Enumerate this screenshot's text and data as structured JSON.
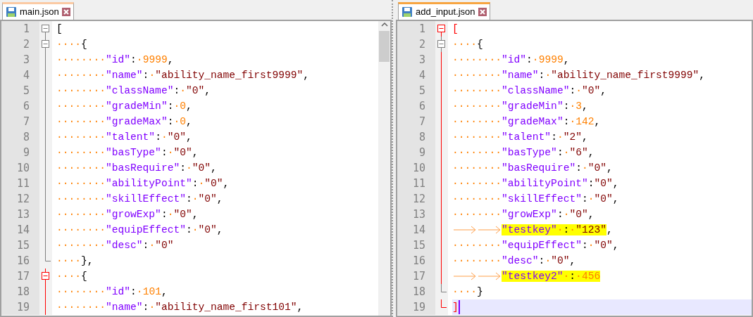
{
  "panes": [
    {
      "focused": false,
      "tab": {
        "label": "main.json",
        "selected": true
      },
      "scrollbar": true,
      "lines": [
        {
          "number": "1",
          "fold_marker": {
            "kind": "box",
            "active": false
          },
          "highlighted": false,
          "current": false,
          "tokens": [
            {
              "kind": "op",
              "text": "["
            }
          ]
        },
        {
          "number": "2",
          "fold_marker": {
            "kind": "box",
            "active": false
          },
          "highlighted": false,
          "current": false,
          "tokens": [
            {
              "kind": "ws",
              "text": "····"
            },
            {
              "kind": "op",
              "text": "{"
            }
          ]
        },
        {
          "number": "3",
          "fold_marker": {
            "kind": "line",
            "active": false
          },
          "highlighted": false,
          "current": false,
          "tokens": [
            {
              "kind": "ws",
              "text": "········"
            },
            {
              "kind": "key",
              "text": "\"id\""
            },
            {
              "kind": "op",
              "text": ":"
            },
            {
              "kind": "ws",
              "text": "·"
            },
            {
              "kind": "num",
              "text": "9999"
            },
            {
              "kind": "op",
              "text": ","
            }
          ]
        },
        {
          "number": "4",
          "fold_marker": {
            "kind": "line",
            "active": false
          },
          "highlighted": false,
          "current": false,
          "tokens": [
            {
              "kind": "ws",
              "text": "········"
            },
            {
              "kind": "key",
              "text": "\"name\""
            },
            {
              "kind": "op",
              "text": ":"
            },
            {
              "kind": "ws",
              "text": "·"
            },
            {
              "kind": "str",
              "text": "\"ability_name_first9999\""
            },
            {
              "kind": "op",
              "text": ","
            }
          ]
        },
        {
          "number": "5",
          "fold_marker": {
            "kind": "line",
            "active": false
          },
          "highlighted": false,
          "current": false,
          "tokens": [
            {
              "kind": "ws",
              "text": "········"
            },
            {
              "kind": "key",
              "text": "\"className\""
            },
            {
              "kind": "op",
              "text": ":"
            },
            {
              "kind": "ws",
              "text": "·"
            },
            {
              "kind": "str",
              "text": "\"0\""
            },
            {
              "kind": "op",
              "text": ","
            }
          ]
        },
        {
          "number": "6",
          "fold_marker": {
            "kind": "line",
            "active": false
          },
          "highlighted": false,
          "current": false,
          "tokens": [
            {
              "kind": "ws",
              "text": "········"
            },
            {
              "kind": "key",
              "text": "\"gradeMin\""
            },
            {
              "kind": "op",
              "text": ":"
            },
            {
              "kind": "ws",
              "text": "·"
            },
            {
              "kind": "num",
              "text": "0"
            },
            {
              "kind": "op",
              "text": ","
            }
          ]
        },
        {
          "number": "7",
          "fold_marker": {
            "kind": "line",
            "active": false
          },
          "highlighted": false,
          "current": false,
          "tokens": [
            {
              "kind": "ws",
              "text": "········"
            },
            {
              "kind": "key",
              "text": "\"gradeMax\""
            },
            {
              "kind": "op",
              "text": ":"
            },
            {
              "kind": "ws",
              "text": "·"
            },
            {
              "kind": "num",
              "text": "0"
            },
            {
              "kind": "op",
              "text": ","
            }
          ]
        },
        {
          "number": "8",
          "fold_marker": {
            "kind": "line",
            "active": false
          },
          "highlighted": false,
          "current": false,
          "tokens": [
            {
              "kind": "ws",
              "text": "········"
            },
            {
              "kind": "key",
              "text": "\"talent\""
            },
            {
              "kind": "op",
              "text": ":"
            },
            {
              "kind": "ws",
              "text": "·"
            },
            {
              "kind": "str",
              "text": "\"0\""
            },
            {
              "kind": "op",
              "text": ","
            }
          ]
        },
        {
          "number": "9",
          "fold_marker": {
            "kind": "line",
            "active": false
          },
          "highlighted": false,
          "current": false,
          "tokens": [
            {
              "kind": "ws",
              "text": "········"
            },
            {
              "kind": "key",
              "text": "\"basType\""
            },
            {
              "kind": "op",
              "text": ":"
            },
            {
              "kind": "ws",
              "text": "·"
            },
            {
              "kind": "str",
              "text": "\"0\""
            },
            {
              "kind": "op",
              "text": ","
            }
          ]
        },
        {
          "number": "10",
          "fold_marker": {
            "kind": "line",
            "active": false
          },
          "highlighted": false,
          "current": false,
          "tokens": [
            {
              "kind": "ws",
              "text": "········"
            },
            {
              "kind": "key",
              "text": "\"basRequire\""
            },
            {
              "kind": "op",
              "text": ":"
            },
            {
              "kind": "ws",
              "text": "·"
            },
            {
              "kind": "str",
              "text": "\"0\""
            },
            {
              "kind": "op",
              "text": ","
            }
          ]
        },
        {
          "number": "11",
          "fold_marker": {
            "kind": "line",
            "active": false
          },
          "highlighted": false,
          "current": false,
          "tokens": [
            {
              "kind": "ws",
              "text": "········"
            },
            {
              "kind": "key",
              "text": "\"abilityPoint\""
            },
            {
              "kind": "op",
              "text": ":"
            },
            {
              "kind": "ws",
              "text": "·"
            },
            {
              "kind": "str",
              "text": "\"0\""
            },
            {
              "kind": "op",
              "text": ","
            }
          ]
        },
        {
          "number": "12",
          "fold_marker": {
            "kind": "line",
            "active": false
          },
          "highlighted": false,
          "current": false,
          "tokens": [
            {
              "kind": "ws",
              "text": "········"
            },
            {
              "kind": "key",
              "text": "\"skillEffect\""
            },
            {
              "kind": "op",
              "text": ":"
            },
            {
              "kind": "ws",
              "text": "·"
            },
            {
              "kind": "str",
              "text": "\"0\""
            },
            {
              "kind": "op",
              "text": ","
            }
          ]
        },
        {
          "number": "13",
          "fold_marker": {
            "kind": "line",
            "active": false
          },
          "highlighted": false,
          "current": false,
          "tokens": [
            {
              "kind": "ws",
              "text": "········"
            },
            {
              "kind": "key",
              "text": "\"growExp\""
            },
            {
              "kind": "op",
              "text": ":"
            },
            {
              "kind": "ws",
              "text": "·"
            },
            {
              "kind": "str",
              "text": "\"0\""
            },
            {
              "kind": "op",
              "text": ","
            }
          ]
        },
        {
          "number": "14",
          "fold_marker": {
            "kind": "line",
            "active": false
          },
          "highlighted": false,
          "current": false,
          "tokens": [
            {
              "kind": "ws",
              "text": "········"
            },
            {
              "kind": "key",
              "text": "\"equipEffect\""
            },
            {
              "kind": "op",
              "text": ":"
            },
            {
              "kind": "ws",
              "text": "·"
            },
            {
              "kind": "str",
              "text": "\"0\""
            },
            {
              "kind": "op",
              "text": ","
            }
          ]
        },
        {
          "number": "15",
          "fold_marker": {
            "kind": "line",
            "active": false
          },
          "highlighted": false,
          "current": false,
          "tokens": [
            {
              "kind": "ws",
              "text": "········"
            },
            {
              "kind": "key",
              "text": "\"desc\""
            },
            {
              "kind": "op",
              "text": ":"
            },
            {
              "kind": "ws",
              "text": "·"
            },
            {
              "kind": "str",
              "text": "\"0\""
            }
          ]
        },
        {
          "number": "16",
          "fold_marker": {
            "kind": "end",
            "active": false
          },
          "highlighted": false,
          "current": false,
          "tokens": [
            {
              "kind": "ws",
              "text": "····"
            },
            {
              "kind": "op",
              "text": "},"
            }
          ]
        },
        {
          "number": "17",
          "fold_marker": {
            "kind": "box",
            "active": true
          },
          "highlighted": false,
          "current": false,
          "tokens": [
            {
              "kind": "ws",
              "text": "····"
            },
            {
              "kind": "op",
              "text": "{"
            }
          ]
        },
        {
          "number": "18",
          "fold_marker": {
            "kind": "line",
            "active": true
          },
          "highlighted": false,
          "current": false,
          "tokens": [
            {
              "kind": "ws",
              "text": "········"
            },
            {
              "kind": "key",
              "text": "\"id\""
            },
            {
              "kind": "op",
              "text": ":"
            },
            {
              "kind": "ws",
              "text": "·"
            },
            {
              "kind": "num",
              "text": "101"
            },
            {
              "kind": "op",
              "text": ","
            }
          ]
        },
        {
          "number": "19",
          "fold_marker": {
            "kind": "line",
            "active": true
          },
          "highlighted": false,
          "current": false,
          "tokens": [
            {
              "kind": "ws",
              "text": "········"
            },
            {
              "kind": "key",
              "text": "\"name\""
            },
            {
              "kind": "op",
              "text": ":"
            },
            {
              "kind": "ws",
              "text": "·"
            },
            {
              "kind": "str",
              "text": "\"ability_name_first101\""
            },
            {
              "kind": "op",
              "text": ","
            }
          ]
        }
      ]
    },
    {
      "focused": true,
      "tab": {
        "label": "add_input.json",
        "selected": true
      },
      "scrollbar": false,
      "lines": [
        {
          "number": "1",
          "fold_marker": {
            "kind": "box",
            "active": true
          },
          "highlighted": false,
          "current": false,
          "tokens": [
            {
              "kind": "match",
              "text": "["
            }
          ]
        },
        {
          "number": "2",
          "fold_marker": {
            "kind": "box",
            "active": false
          },
          "highlighted": false,
          "current": false,
          "tokens": [
            {
              "kind": "ws",
              "text": "····"
            },
            {
              "kind": "op",
              "text": "{"
            }
          ]
        },
        {
          "number": "3",
          "fold_marker": {
            "kind": "line",
            "active": true
          },
          "highlighted": false,
          "current": false,
          "tokens": [
            {
              "kind": "ws",
              "text": "········"
            },
            {
              "kind": "key",
              "text": "\"id\""
            },
            {
              "kind": "op",
              "text": ":"
            },
            {
              "kind": "ws",
              "text": "·"
            },
            {
              "kind": "num",
              "text": "9999"
            },
            {
              "kind": "op",
              "text": ","
            }
          ]
        },
        {
          "number": "4",
          "fold_marker": {
            "kind": "line",
            "active": true
          },
          "highlighted": false,
          "current": false,
          "tokens": [
            {
              "kind": "ws",
              "text": "········"
            },
            {
              "kind": "key",
              "text": "\"name\""
            },
            {
              "kind": "op",
              "text": ":"
            },
            {
              "kind": "ws",
              "text": "·"
            },
            {
              "kind": "str",
              "text": "\"ability_name_first9999\""
            },
            {
              "kind": "op",
              "text": ","
            }
          ]
        },
        {
          "number": "5",
          "fold_marker": {
            "kind": "line",
            "active": true
          },
          "highlighted": false,
          "current": false,
          "tokens": [
            {
              "kind": "ws",
              "text": "········"
            },
            {
              "kind": "key",
              "text": "\"className\""
            },
            {
              "kind": "op",
              "text": ":"
            },
            {
              "kind": "ws",
              "text": "·"
            },
            {
              "kind": "str",
              "text": "\"0\""
            },
            {
              "kind": "op",
              "text": ","
            }
          ]
        },
        {
          "number": "6",
          "fold_marker": {
            "kind": "line",
            "active": true
          },
          "highlighted": false,
          "current": false,
          "tokens": [
            {
              "kind": "ws",
              "text": "········"
            },
            {
              "kind": "key",
              "text": "\"gradeMin\""
            },
            {
              "kind": "op",
              "text": ":"
            },
            {
              "kind": "ws",
              "text": "·"
            },
            {
              "kind": "num",
              "text": "3"
            },
            {
              "kind": "op",
              "text": ","
            }
          ]
        },
        {
          "number": "7",
          "fold_marker": {
            "kind": "line",
            "active": true
          },
          "highlighted": false,
          "current": false,
          "tokens": [
            {
              "kind": "ws",
              "text": "········"
            },
            {
              "kind": "key",
              "text": "\"gradeMax\""
            },
            {
              "kind": "op",
              "text": ":"
            },
            {
              "kind": "ws",
              "text": "·"
            },
            {
              "kind": "num",
              "text": "142"
            },
            {
              "kind": "op",
              "text": ","
            }
          ]
        },
        {
          "number": "8",
          "fold_marker": {
            "kind": "line",
            "active": true
          },
          "highlighted": false,
          "current": false,
          "tokens": [
            {
              "kind": "ws",
              "text": "········"
            },
            {
              "kind": "key",
              "text": "\"talent\""
            },
            {
              "kind": "op",
              "text": ":"
            },
            {
              "kind": "ws",
              "text": "·"
            },
            {
              "kind": "str",
              "text": "\"2\""
            },
            {
              "kind": "op",
              "text": ","
            }
          ]
        },
        {
          "number": "9",
          "fold_marker": {
            "kind": "line",
            "active": true
          },
          "highlighted": false,
          "current": false,
          "tokens": [
            {
              "kind": "ws",
              "text": "········"
            },
            {
              "kind": "key",
              "text": "\"basType\""
            },
            {
              "kind": "op",
              "text": ":"
            },
            {
              "kind": "ws",
              "text": "·"
            },
            {
              "kind": "str",
              "text": "\"6\""
            },
            {
              "kind": "op",
              "text": ","
            }
          ]
        },
        {
          "number": "10",
          "fold_marker": {
            "kind": "line",
            "active": true
          },
          "highlighted": false,
          "current": false,
          "tokens": [
            {
              "kind": "ws",
              "text": "········"
            },
            {
              "kind": "key",
              "text": "\"basRequire\""
            },
            {
              "kind": "op",
              "text": ":"
            },
            {
              "kind": "ws",
              "text": "·"
            },
            {
              "kind": "str",
              "text": "\"0\""
            },
            {
              "kind": "op",
              "text": ","
            }
          ]
        },
        {
          "number": "11",
          "fold_marker": {
            "kind": "line",
            "active": true
          },
          "highlighted": false,
          "current": false,
          "tokens": [
            {
              "kind": "ws",
              "text": "········"
            },
            {
              "kind": "key",
              "text": "\"abilityPoint\""
            },
            {
              "kind": "op",
              "text": ":"
            },
            {
              "kind": "str",
              "text": "\"0\""
            },
            {
              "kind": "op",
              "text": ","
            }
          ]
        },
        {
          "number": "12",
          "fold_marker": {
            "kind": "line",
            "active": true
          },
          "highlighted": false,
          "current": false,
          "tokens": [
            {
              "kind": "ws",
              "text": "········"
            },
            {
              "kind": "key",
              "text": "\"skillEffect\""
            },
            {
              "kind": "op",
              "text": ":"
            },
            {
              "kind": "ws",
              "text": "·"
            },
            {
              "kind": "str",
              "text": "\"0\""
            },
            {
              "kind": "op",
              "text": ","
            }
          ]
        },
        {
          "number": "13",
          "fold_marker": {
            "kind": "line",
            "active": true
          },
          "highlighted": false,
          "current": false,
          "tokens": [
            {
              "kind": "ws",
              "text": "········"
            },
            {
              "kind": "key",
              "text": "\"growExp\""
            },
            {
              "kind": "op",
              "text": ":"
            },
            {
              "kind": "ws",
              "text": "·"
            },
            {
              "kind": "str",
              "text": "\"0\""
            },
            {
              "kind": "op",
              "text": ","
            }
          ]
        },
        {
          "number": "14",
          "fold_marker": {
            "kind": "line",
            "active": true
          },
          "highlighted": true,
          "current": false,
          "tokens": [
            {
              "kind": "tab"
            },
            {
              "kind": "tab"
            },
            {
              "kind": "key",
              "text": "\"testkey\""
            },
            {
              "kind": "ws",
              "text": "·"
            },
            {
              "kind": "op",
              "text": ":"
            },
            {
              "kind": "ws",
              "text": "·"
            },
            {
              "kind": "str",
              "text": "\"123\""
            },
            {
              "kind": "op",
              "text": ","
            }
          ]
        },
        {
          "number": "15",
          "fold_marker": {
            "kind": "line",
            "active": true
          },
          "highlighted": false,
          "current": false,
          "tokens": [
            {
              "kind": "ws",
              "text": "········"
            },
            {
              "kind": "key",
              "text": "\"equipEffect\""
            },
            {
              "kind": "op",
              "text": ":"
            },
            {
              "kind": "ws",
              "text": "·"
            },
            {
              "kind": "str",
              "text": "\"0\""
            },
            {
              "kind": "op",
              "text": ","
            }
          ]
        },
        {
          "number": "16",
          "fold_marker": {
            "kind": "line",
            "active": true
          },
          "highlighted": false,
          "current": false,
          "tokens": [
            {
              "kind": "ws",
              "text": "········"
            },
            {
              "kind": "key",
              "text": "\"desc\""
            },
            {
              "kind": "op",
              "text": ":"
            },
            {
              "kind": "ws",
              "text": "·"
            },
            {
              "kind": "str",
              "text": "\"0\""
            },
            {
              "kind": "op",
              "text": ","
            }
          ]
        },
        {
          "number": "17",
          "fold_marker": {
            "kind": "line",
            "active": true
          },
          "highlighted": true,
          "current": false,
          "tokens": [
            {
              "kind": "tab"
            },
            {
              "kind": "tab"
            },
            {
              "kind": "key",
              "text": "\"testkey2\""
            },
            {
              "kind": "ws",
              "text": "·"
            },
            {
              "kind": "op",
              "text": ":"
            },
            {
              "kind": "ws",
              "text": "·"
            },
            {
              "kind": "num",
              "text": "456"
            }
          ]
        },
        {
          "number": "18",
          "fold_marker": {
            "kind": "end",
            "active": false
          },
          "highlighted": false,
          "current": false,
          "tokens": [
            {
              "kind": "ws",
              "text": "····"
            },
            {
              "kind": "op",
              "text": "}"
            }
          ]
        },
        {
          "number": "19",
          "fold_marker": {
            "kind": "end",
            "active": true
          },
          "highlighted": false,
          "current": true,
          "tokens": [
            {
              "kind": "match",
              "text": "]"
            }
          ]
        }
      ]
    }
  ]
}
